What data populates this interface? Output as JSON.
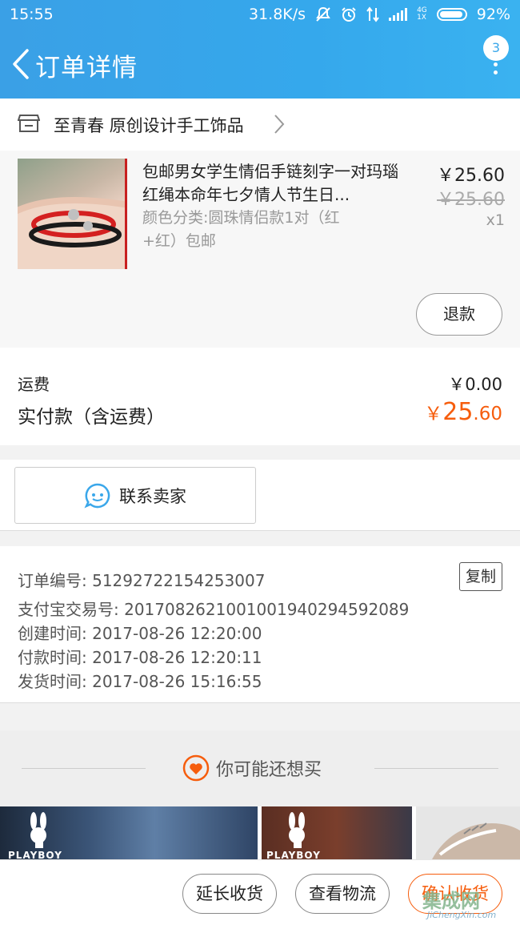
{
  "status_bar": {
    "time": "15:55",
    "net_speed": "31.8K/s",
    "net_tag_top": "4G",
    "net_tag_bottom": "1X",
    "battery": "92%"
  },
  "header": {
    "title": "订单详情",
    "badge_count": "3"
  },
  "shop": {
    "name": "至青春  原创设计手工饰品"
  },
  "product": {
    "title": "包邮男女学生情侣手链刻字一对玛瑙红绳本命年七夕情人节生日...",
    "sku": "颜色分类:圆珠情侣款1对（红+红）包邮",
    "price": "￥25.60",
    "original_price": "￥25.60",
    "quantity": "x1",
    "refund_label": "退款"
  },
  "fees": {
    "shipping_label": "运费",
    "shipping_value": "￥0.00",
    "paid_label": "实付款（含运费）",
    "paid_currency": "￥",
    "paid_integer": "25",
    "paid_decimal": ".60"
  },
  "contact": {
    "label": "联系卖家"
  },
  "order_info": {
    "order_no": "订单编号: 51292722154253007",
    "copy_label": "复制",
    "alipay_no": "支付宝交易号: 2017082621001001940294592089",
    "created": "创建时间: 2017-08-26 12:20:00",
    "paid": "付款时间: 2017-08-26 12:20:11",
    "shipped": "发货时间: 2017-08-26 15:16:55"
  },
  "recommend": {
    "title": "你可能还想买",
    "brand_text": "PLAYBOY"
  },
  "bottom_bar": {
    "extend_label": "延长收货",
    "logistics_label": "查看物流",
    "confirm_label": "确认收货"
  },
  "watermark": {
    "cn": "集成网",
    "en": "JiChengXin.com"
  },
  "colors": {
    "header_blue": "#35a8ec",
    "accent_orange": "#f65d0d",
    "icon_blue": "#3aa7ea"
  }
}
